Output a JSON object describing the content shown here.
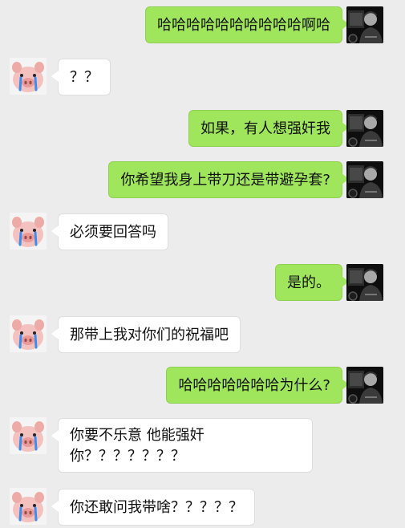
{
  "messages": [
    {
      "sender": "me",
      "text": "哈哈哈哈哈哈哈哈哈哈啊哈"
    },
    {
      "sender": "other",
      "text": "？？"
    },
    {
      "sender": "me",
      "text": "如果，有人想强奸我"
    },
    {
      "sender": "me",
      "text": "你希望我身上带刀还是带避孕套?"
    },
    {
      "sender": "other",
      "text": "必须要回答吗"
    },
    {
      "sender": "me",
      "text": "是的。"
    },
    {
      "sender": "other",
      "text": "那带上我对你们的祝福吧"
    },
    {
      "sender": "me",
      "text": "哈哈哈哈哈哈哈为什么?"
    },
    {
      "sender": "other",
      "text": "你要不乐意 他能强奸你？？？？？？？"
    },
    {
      "sender": "other",
      "text": "你还敢问我带啥？？？？？"
    }
  ],
  "colors": {
    "background": "#ececec",
    "self_bubble": "#9fe65d",
    "other_bubble": "#ffffff"
  },
  "icons": {
    "self_avatar": "man-photo-avatar-icon",
    "other_avatar": "crying-pig-avatar-icon"
  }
}
